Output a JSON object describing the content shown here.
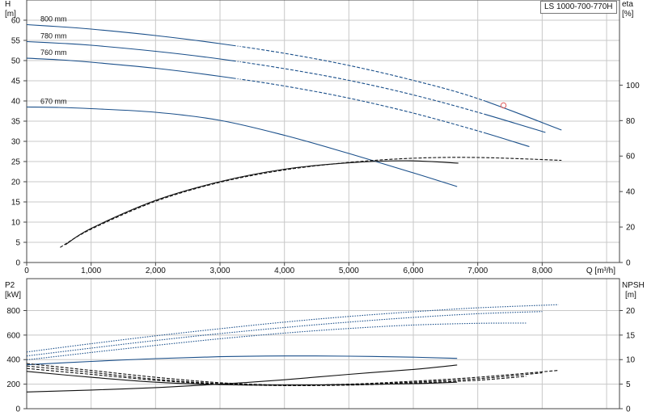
{
  "model_label": "LS 1000-700-770H",
  "chart_data": [
    {
      "type": "line",
      "title": "",
      "xlabel": "Q [m³/h]",
      "ylabel": "H\n[m]",
      "y2label": "eta\n[%]",
      "xlim": [
        0,
        9200
      ],
      "ylim": [
        0,
        65
      ],
      "y2lim": [
        0,
        148
      ],
      "x_ticks": [
        "0",
        "1,000",
        "2,000",
        "3,000",
        "4,000",
        "5,000",
        "6,000",
        "7,000",
        "8,000"
      ],
      "y_ticks": [
        "0",
        "5",
        "10",
        "15",
        "20",
        "25",
        "30",
        "35",
        "40",
        "45",
        "50",
        "55",
        "60"
      ],
      "y2_ticks": [
        "0",
        "20",
        "40",
        "60",
        "80",
        "100"
      ],
      "grid": true,
      "operating_point": {
        "x": 7400,
        "y": 38.9,
        "color": "#e06060"
      },
      "series": [
        {
          "name": "800 mm",
          "axis": "left",
          "color": "#1a4f8a",
          "style": "solid-to-dashed",
          "x": [
            0,
            500,
            1000,
            2000,
            3000,
            4000,
            5000,
            6000,
            7000,
            8300
          ],
          "y": [
            58.9,
            58.4,
            57.8,
            56.2,
            54.2,
            51.8,
            48.8,
            45.1,
            40.6,
            32.8
          ]
        },
        {
          "name": "780 mm",
          "axis": "left",
          "color": "#1a4f8a",
          "style": "solid-to-dashed",
          "x": [
            0,
            500,
            1000,
            2000,
            3000,
            4000,
            5000,
            6000,
            7000,
            8050
          ],
          "y": [
            54.7,
            54.3,
            53.8,
            52.3,
            50.4,
            48.0,
            45.1,
            41.5,
            37.2,
            32.2
          ]
        },
        {
          "name": "760 mm",
          "axis": "left",
          "color": "#1a4f8a",
          "style": "solid-to-dashed",
          "x": [
            0,
            500,
            1000,
            2000,
            3000,
            4000,
            5000,
            6000,
            7000,
            7800
          ],
          "y": [
            50.6,
            50.2,
            49.6,
            48.1,
            46.1,
            43.7,
            40.7,
            37.0,
            32.6,
            28.7
          ]
        },
        {
          "name": "670 mm",
          "axis": "left",
          "color": "#1a4f8a",
          "style": "solid",
          "x": [
            0,
            500,
            1000,
            2000,
            3000,
            4000,
            5000,
            6000,
            6680
          ],
          "y": [
            38.5,
            38.4,
            38.1,
            37.2,
            35.2,
            31.5,
            27.0,
            22.2,
            18.8
          ]
        },
        {
          "name": "",
          "axis": "right",
          "color": "#111111",
          "style": "dashed",
          "x": [
            520,
            1000,
            2000,
            3000,
            4000,
            5000,
            6000,
            7000,
            8300
          ],
          "y": [
            8.5,
            18.8,
            34.5,
            45.2,
            52.2,
            56.4,
            58.8,
            59.2,
            57.6
          ]
        },
        {
          "name": "",
          "axis": "right",
          "color": "#111111",
          "style": "solid",
          "x": [
            600,
            1000,
            2000,
            3000,
            4000,
            5000,
            5900,
            6700
          ],
          "y": [
            10.0,
            19.2,
            35.0,
            45.6,
            52.6,
            56.2,
            57.4,
            56.0
          ]
        }
      ]
    },
    {
      "type": "line",
      "title": "",
      "xlabel": "",
      "ylabel": "P2\n[kW]",
      "y2label": "NPSH\n[m]",
      "xlim": [
        0,
        9200
      ],
      "ylim": [
        0,
        1060
      ],
      "y2lim": [
        0,
        26.5
      ],
      "y_ticks": [
        "0",
        "200",
        "400",
        "600",
        "800"
      ],
      "y2_ticks": [
        "0",
        "5",
        "10",
        "15",
        "20"
      ],
      "grid": true,
      "series": [
        {
          "name": "",
          "axis": "left",
          "color": "#1a4f8a",
          "style": "dotted",
          "x": [
            0,
            1000,
            2000,
            3000,
            4000,
            5000,
            6000,
            7000,
            8250
          ],
          "y": [
            462,
            530,
            594,
            652,
            706,
            752,
            790,
            822,
            848
          ]
        },
        {
          "name": "",
          "axis": "left",
          "color": "#1a4f8a",
          "style": "dotted",
          "x": [
            0,
            1000,
            2000,
            3000,
            4000,
            5000,
            6000,
            7000,
            8000
          ],
          "y": [
            430,
            494,
            556,
            612,
            662,
            706,
            744,
            774,
            792
          ]
        },
        {
          "name": "",
          "axis": "left",
          "color": "#1a4f8a",
          "style": "dotted",
          "x": [
            0,
            1000,
            2000,
            3000,
            4000,
            5000,
            6000,
            7000,
            7750
          ],
          "y": [
            398,
            458,
            516,
            570,
            616,
            654,
            682,
            696,
            698
          ]
        },
        {
          "name": "",
          "axis": "left",
          "color": "#1a4f8a",
          "style": "solid",
          "x": [
            0,
            1000,
            2000,
            3000,
            4000,
            5000,
            6000,
            6680
          ],
          "y": [
            358,
            385,
            408,
            424,
            430,
            428,
            420,
            410
          ]
        },
        {
          "name": "",
          "axis": "right",
          "color": "#111111",
          "style": "dashed",
          "x": [
            0,
            1000,
            2000,
            3000,
            4000,
            5000,
            6000,
            7000,
            8250
          ],
          "y": [
            9.2,
            7.8,
            6.4,
            5.3,
            4.8,
            5.0,
            5.6,
            6.4,
            7.8
          ]
        },
        {
          "name": "",
          "axis": "right",
          "color": "#111111",
          "style": "dashed",
          "x": [
            0,
            1000,
            2000,
            3000,
            4000,
            5000,
            6000,
            7000,
            8000
          ],
          "y": [
            8.7,
            7.4,
            6.0,
            5.1,
            4.8,
            4.9,
            5.4,
            6.1,
            7.3
          ]
        },
        {
          "name": "",
          "axis": "right",
          "color": "#111111",
          "style": "dashed",
          "x": [
            0,
            1000,
            2000,
            3000,
            4000,
            5000,
            6000,
            7000,
            7750
          ],
          "y": [
            8.2,
            7.0,
            5.8,
            5.0,
            4.7,
            4.8,
            5.2,
            5.8,
            6.6
          ]
        },
        {
          "name": "",
          "axis": "right",
          "color": "#111111",
          "style": "solid",
          "x": [
            0,
            1000,
            2000,
            3000,
            4000,
            5000,
            6000,
            6680
          ],
          "y": [
            7.6,
            6.4,
            5.4,
            4.9,
            4.8,
            4.9,
            5.1,
            5.4
          ]
        },
        {
          "name": "",
          "axis": "right",
          "color": "#111111",
          "style": "solid",
          "x": [
            0,
            1000,
            2000,
            3000,
            4000,
            5000,
            6000,
            6680
          ],
          "y": [
            3.4,
            3.8,
            4.3,
            5.0,
            5.9,
            7.0,
            8.0,
            8.9
          ]
        }
      ]
    }
  ]
}
